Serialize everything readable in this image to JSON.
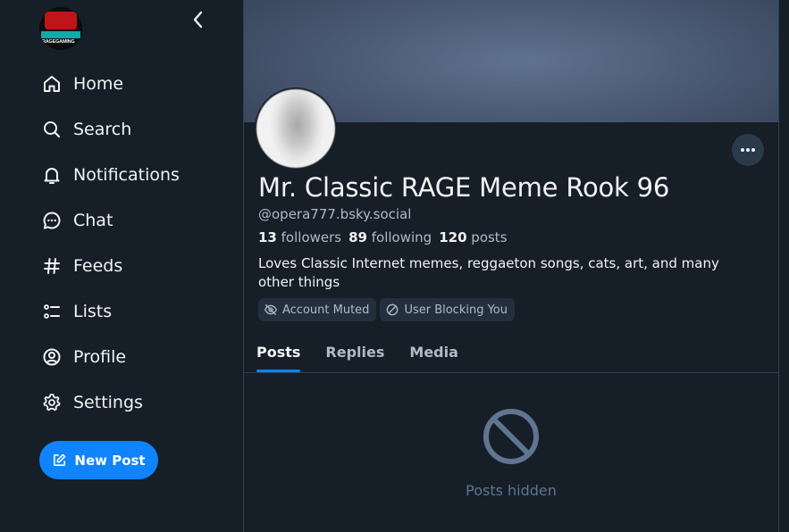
{
  "sidebar": {
    "avatar_text": "RAGEGAMING",
    "nav": [
      {
        "label": "Home",
        "icon": "home-icon"
      },
      {
        "label": "Search",
        "icon": "search-icon"
      },
      {
        "label": "Notifications",
        "icon": "bell-icon"
      },
      {
        "label": "Chat",
        "icon": "chat-icon"
      },
      {
        "label": "Feeds",
        "icon": "hash-icon"
      },
      {
        "label": "Lists",
        "icon": "list-icon"
      },
      {
        "label": "Profile",
        "icon": "user-circle-icon"
      },
      {
        "label": "Settings",
        "icon": "gear-icon"
      }
    ],
    "new_post_label": "New Post"
  },
  "profile": {
    "display_name": "Mr. Classic RAGE Meme Rook 96",
    "handle": "@opera777.bsky.social",
    "followers_count": "13",
    "followers_label": "followers",
    "following_count": "89",
    "following_label": "following",
    "posts_count": "120",
    "posts_label": "posts",
    "bio": "Loves Classic Internet memes, reggaeton songs, cats, art, and many other things",
    "badges": [
      {
        "label": "Account Muted",
        "icon": "eye-slash-icon"
      },
      {
        "label": "User Blocking You",
        "icon": "block-icon"
      }
    ]
  },
  "tabs": [
    {
      "label": "Posts",
      "active": true
    },
    {
      "label": "Replies",
      "active": false
    },
    {
      "label": "Media",
      "active": false
    }
  ],
  "empty_state": {
    "icon": "prohibited-icon",
    "text": "Posts hidden"
  },
  "colors": {
    "background": "#161e27",
    "accent": "#1083fe",
    "text_primary": "#f1f3f5",
    "text_secondary": "#aebbc9",
    "muted": "#5f7590"
  }
}
